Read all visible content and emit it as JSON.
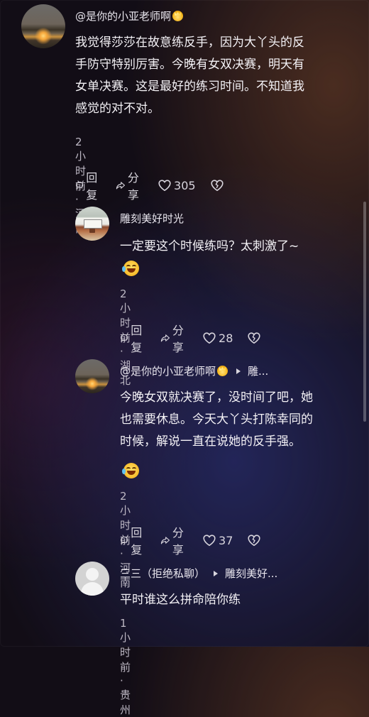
{
  "comments": [
    {
      "author": "@是你的小亚老师啊",
      "text_lines": [
        "我觉得莎莎在故意练反手，因为大丫头的反",
        "手防守特别厉害。今晚有女双决赛，明天有",
        "女单决赛。这是最好的练习时间。不知道我",
        "感觉的对不对。"
      ],
      "meta": "2小时前·河南",
      "reply_label": "回复",
      "share_label": "分享",
      "likes": "305"
    },
    {
      "author": "雕刻美好时光",
      "text_lines": [
        "一定要这个时候练吗？太刺激了~"
      ],
      "meta": "2小时前·湖北",
      "reply_label": "回复",
      "share_label": "分享",
      "likes": "28"
    },
    {
      "author": "@是你的小亚老师啊",
      "reply_to": "雕...",
      "text_lines": [
        "今晚女双就决赛了，没时间了吧，她",
        "也需要休息。今天大丫头打陈幸同的",
        "时候，解说一直在说她的反手强。"
      ],
      "meta": "2小时前·河南",
      "reply_label": "回复",
      "share_label": "分享",
      "likes": "37"
    },
    {
      "author": "三三（拒绝私聊）",
      "reply_to": "雕刻美好...",
      "text_lines": [
        "平时谁这么拼命陪你练"
      ],
      "meta": "1小时前·贵州"
    }
  ],
  "icons": {
    "comment": "speech-bubble-icon",
    "share": "share-arrow-icon",
    "like": "heart-icon",
    "dislike": "broken-heart-icon",
    "emoji_laugh": "laughing-emoji-icon",
    "crown": "crown-badge-icon"
  },
  "colors": {
    "text": "#f4f2f6",
    "secondary": "#bdb8c4",
    "badge": "#f4b41a"
  }
}
